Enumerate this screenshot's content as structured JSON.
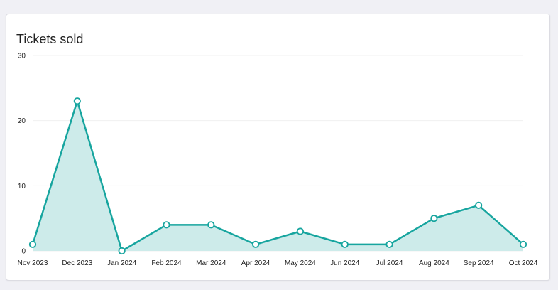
{
  "card": {
    "title": "Tickets sold"
  },
  "colors": {
    "line": "#17a59f",
    "area": "#cdebea",
    "grid": "#f0f0f0",
    "background": "#f0f0f5"
  },
  "chart_data": {
    "type": "area",
    "title": "Tickets sold",
    "xlabel": "",
    "ylabel": "",
    "categories": [
      "Nov 2023",
      "Dec 2023",
      "Jan 2024",
      "Feb 2024",
      "Mar 2024",
      "Apr 2024",
      "May 2024",
      "Jun 2024",
      "Jul 2024",
      "Aug 2024",
      "Sep 2024",
      "Oct 2024"
    ],
    "series": [
      {
        "values": [
          1,
          23,
          0,
          4,
          4,
          1,
          3,
          1,
          1,
          5,
          7,
          1
        ]
      }
    ],
    "y_ticks": [
      "0",
      "10",
      "20",
      "30"
    ],
    "ylim": [
      0,
      30
    ],
    "grid": true,
    "legend": "none",
    "markers": "hollow circles"
  }
}
